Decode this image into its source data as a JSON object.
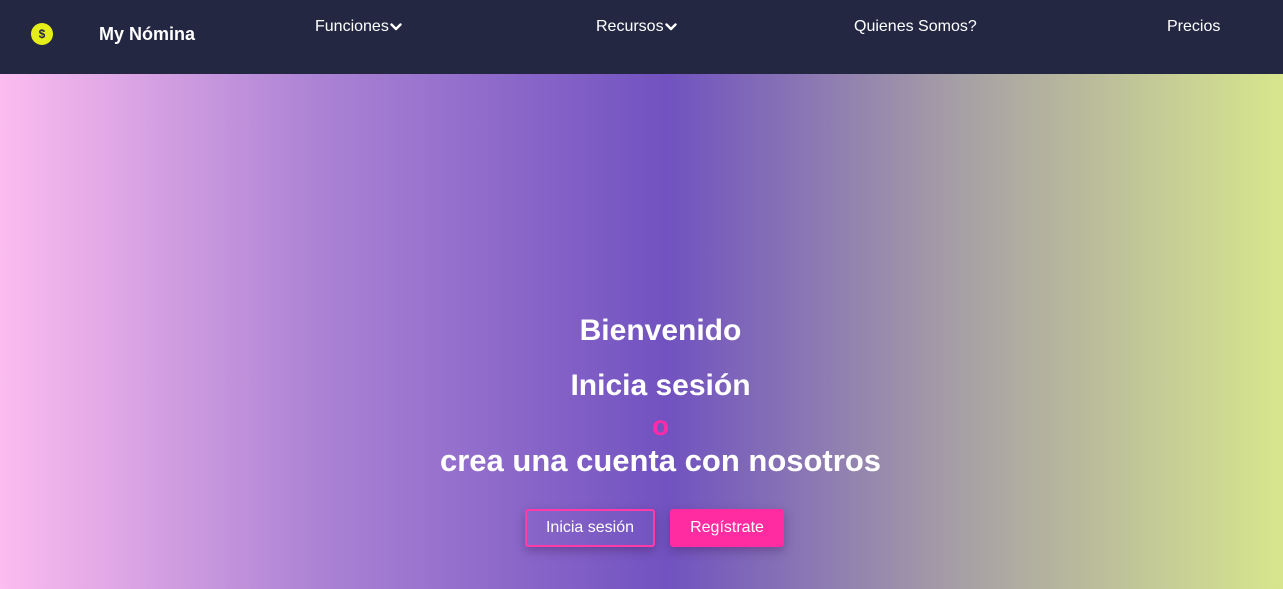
{
  "nav": {
    "logo_symbol": "$",
    "brand": "My Nómina",
    "items": [
      {
        "label": "Funciones",
        "dropdown": true
      },
      {
        "label": "Recursos",
        "dropdown": true
      },
      {
        "label": "Quienes Somos?",
        "dropdown": false
      },
      {
        "label": "Precios",
        "dropdown": false
      }
    ]
  },
  "hero": {
    "line1": "Bienvenido",
    "line2": "Inicia sesión",
    "line3": "o",
    "line4": "crea una cuenta con nosotros",
    "login_button": "Inicia sesión",
    "register_button": "Regístrate"
  },
  "colors": {
    "nav_bg": "#232742",
    "accent_pink": "#ff2ba0",
    "logo_yellow": "#e6ee1a"
  }
}
